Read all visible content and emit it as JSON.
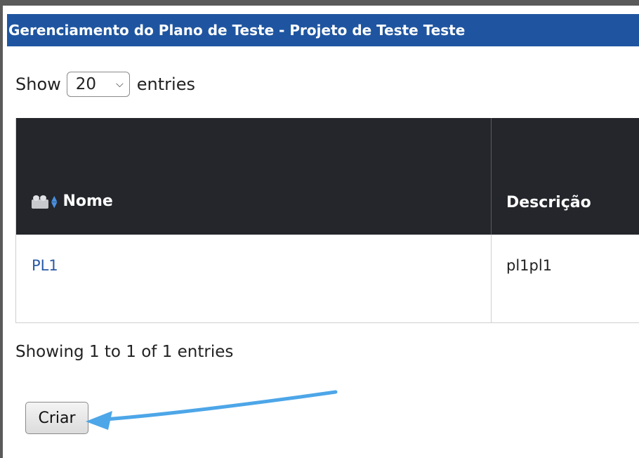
{
  "header": {
    "title": "Gerenciamento do Plano de Teste - Projeto de Teste Teste"
  },
  "length_menu": {
    "prefix": "Show",
    "selected": "20",
    "suffix": "entries"
  },
  "table": {
    "columns": [
      "Nome",
      "Descrição"
    ],
    "rows": [
      {
        "nome": "PL1",
        "descricao": "pl1pl1"
      }
    ]
  },
  "info_text": "Showing 1 to 1 of 1 entries",
  "actions": {
    "create_label": "Criar"
  },
  "colors": {
    "title_bar": "#1f55a0",
    "table_header": "#24262b",
    "link": "#2a5aa6",
    "annotation_arrow": "#4da6e8"
  }
}
